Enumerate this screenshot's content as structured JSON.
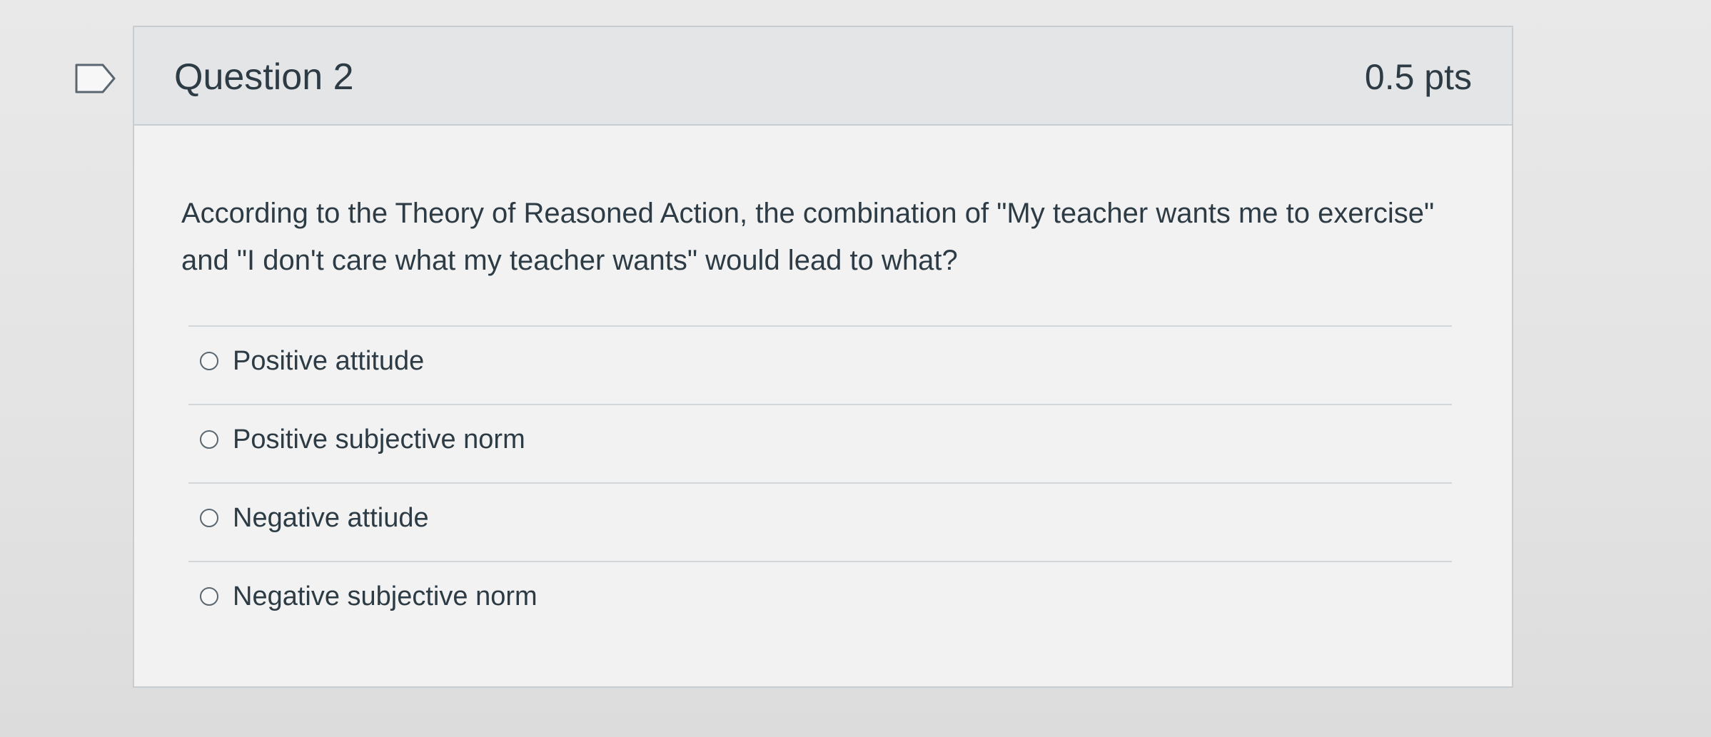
{
  "icons": {
    "flag": "flag-icon",
    "radio": "radio-circle-icon"
  },
  "colors": {
    "text": "#2d3b45",
    "header_bg": "#e4e5e6",
    "card_bg": "#f2f2f2",
    "border": "#c7cdd1"
  },
  "question": {
    "title": "Question 2",
    "points": "0.5 pts",
    "text": "According to the Theory of Reasoned Action, the  combination of \"My teacher wants me to exercise\" and \"I don't care what my teacher wants\" would lead to what?",
    "answers": [
      {
        "label": "Positive attitude",
        "selected": false
      },
      {
        "label": "Positive subjective norm",
        "selected": false
      },
      {
        "label": "Negative attiude",
        "selected": false
      },
      {
        "label": "Negative subjective norm",
        "selected": false
      }
    ]
  }
}
